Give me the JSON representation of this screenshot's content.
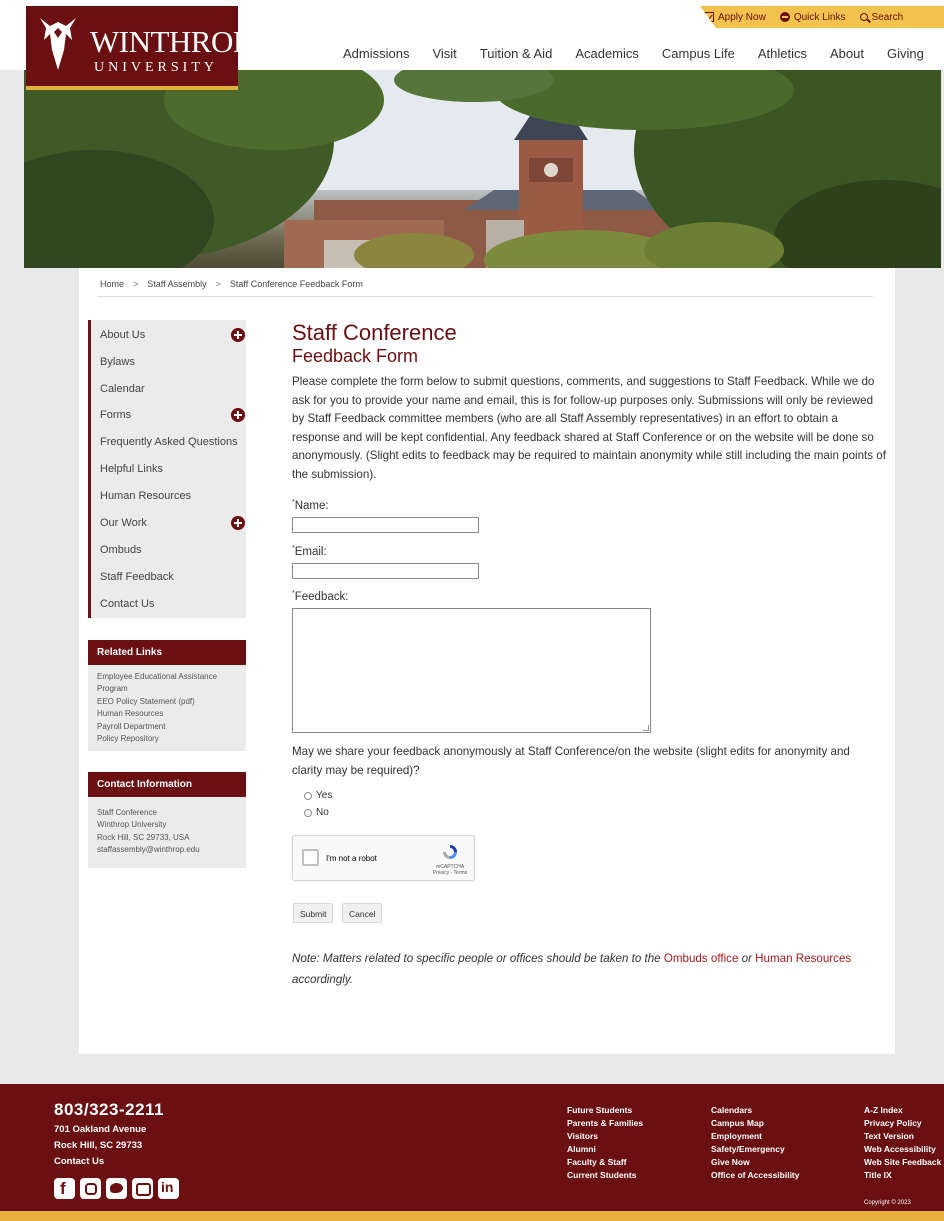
{
  "logo": {
    "word": "WINTHROP",
    "sub": "UNIVERSITY"
  },
  "utility": {
    "apply": "Apply Now",
    "quick": "Quick Links",
    "search": "Search"
  },
  "nav": [
    "Admissions",
    "Visit",
    "Tuition & Aid",
    "Academics",
    "Campus Life",
    "Athletics",
    "About",
    "Giving"
  ],
  "breadcrumb": {
    "home": "Home",
    "section": "Staff Assembly",
    "current": "Staff Conference Feedback Form",
    "sep": ">"
  },
  "sidebar": {
    "items": [
      "About Us",
      "Bylaws",
      "Calendar",
      "Forms",
      "Frequently Asked Questions",
      "Helpful Links",
      "Human Resources",
      "Our Work",
      "Ombuds",
      "Staff Feedback",
      "Contact Us"
    ]
  },
  "related": {
    "title": "Related Links",
    "links": [
      "Employee Educational Assistance Program",
      "EEO Policy Statement (pdf)",
      "Human Resources",
      "Payroll Department",
      "Policy Repository"
    ]
  },
  "contact": {
    "title": "Contact Information",
    "lines": [
      "Staff Conference",
      "Winthrop University",
      "Rock Hill, SC 29733, USA",
      "staffassembly@winthrop.edu"
    ]
  },
  "main": {
    "title1": "Staff Conference",
    "title2": "Feedback Form",
    "intro": "Please complete the form below to submit questions, comments, and suggestions to Staff Feedback. While we do ask for you to provide your name and email, this is for follow-up purposes only.  Submissions will only be reviewed by Staff Feedback committee members (who are all Staff Assembly representatives) in an effort to obtain a response and will be kept confidential. Any feedback shared at Staff Conference or on the website will be done so anonymously. (Slight edits to feedback may be required to maintain anonymity while still including the main points of the submission).",
    "required_mark": "*",
    "name_label": "Name:",
    "email_label": "Email:",
    "feedback_label": "Feedback:",
    "question": "May we share your feedback anonymously at Staff Conference/on the website (slight edits for anonymity and clarity may be required)?",
    "yes": "Yes",
    "no": "No",
    "captcha_label": "I'm not a robot",
    "captcha_brand": "reCAPTCHA",
    "captcha_terms": "Privacy - Terms",
    "submit": "Submit",
    "cancel": "Cancel",
    "note_prefix": "Note: Matters related to specific people or offices should be taken to the ",
    "note_link1": "Ombuds office",
    "note_mid": " or ",
    "note_link2": "Human Resources",
    "note_suffix": " accordingly."
  },
  "footer": {
    "phone": "803/323-2211",
    "address": [
      "701 Oakland Avenue",
      "Rock Hill, SC 29733",
      "Contact Us"
    ],
    "col1": [
      "Future Students",
      "Parents & Families",
      "Visitors",
      "Alumni",
      "Faculty & Staff",
      "Current Students"
    ],
    "col2": [
      "Calendars",
      "Campus Map",
      "Employment",
      "Safety/Emergency",
      "Give Now",
      "Office of Accessibility"
    ],
    "col3": [
      "A-Z Index",
      "Privacy Policy",
      "Text Version",
      "Web Accessibility",
      "Web Site Feedback",
      "Title IX"
    ],
    "copyright": "Copyright © 2023"
  },
  "colors": {
    "maroon": "#6a0f12",
    "gold": "#f1c24d",
    "link": "#a81a1f"
  }
}
